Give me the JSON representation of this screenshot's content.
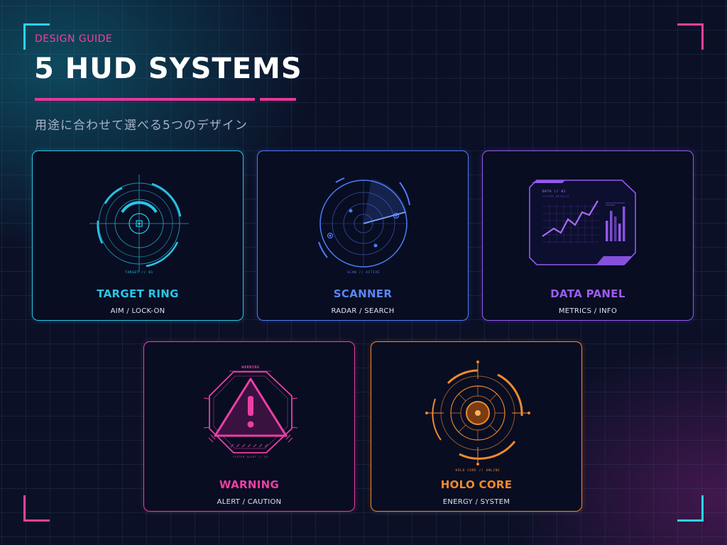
{
  "header": {
    "eyebrow": "DESIGN GUIDE",
    "title": "5 HUD SYSTEMS",
    "subtitle": "用途に合わせて選べる5つのデザイン"
  },
  "colors": {
    "background": "#0b1026",
    "accent_pink": "#e8359a",
    "accent_cyan": "#2bd4f0"
  },
  "cards": [
    {
      "id": "target-ring",
      "name": "TARGET RING",
      "subtitle": "AIM / LOCK-ON",
      "caption": "TARGET // 01",
      "color": "#27c6e8",
      "icon": "target-ring-icon"
    },
    {
      "id": "scanner",
      "name": "SCANNER",
      "subtitle": "RADAR / SEARCH",
      "caption": "SCAN // ACTIVE",
      "color": "#4d7cf4",
      "icon": "radar-icon"
    },
    {
      "id": "data-panel",
      "name": "DATA PANEL",
      "subtitle": "METRICS / INFO",
      "caption": "DATA // 01",
      "caption2": "SYSTEM METRICS",
      "color": "#9558f0",
      "icon": "data-chart-icon"
    },
    {
      "id": "warning",
      "name": "WARNING",
      "subtitle": "ALERT / CAUTION",
      "caption": "WARNING",
      "caption2": "SYSTEM ALERT // 01",
      "color": "#ec3fa4",
      "icon": "warning-triangle-icon"
    },
    {
      "id": "holo-core",
      "name": "HOLO CORE",
      "subtitle": "ENERGY / SYSTEM",
      "caption": "HOLO CORE // ONLINE",
      "color": "#f08a2c",
      "icon": "holo-core-icon"
    }
  ]
}
